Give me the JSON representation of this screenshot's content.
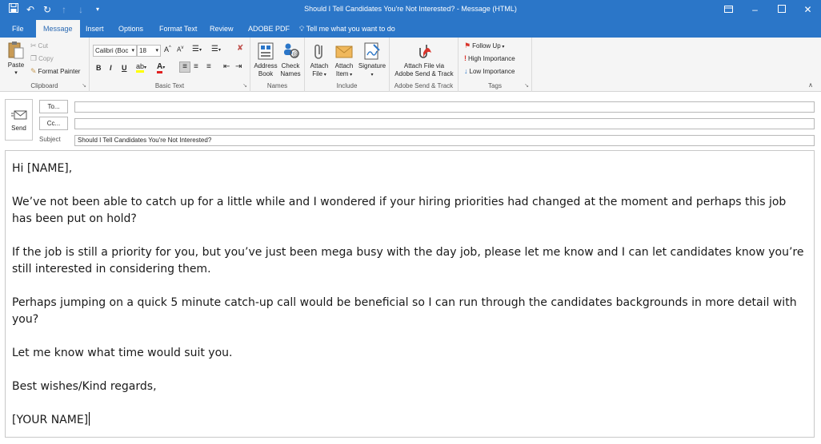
{
  "titlebar": {
    "title": "Should I Tell Candidates You're Not Interested?  -  Message (HTML)",
    "qat_icons": [
      "save-icon",
      "undo-icon",
      "redo-icon",
      "arrow-up-icon",
      "arrow-down-icon",
      "customize-icon"
    ],
    "controls": [
      "ribbon-display-icon",
      "minimize-icon",
      "maximize-icon",
      "close-icon"
    ]
  },
  "tabs": {
    "file": "File",
    "message": "Message",
    "insert": "Insert",
    "options": "Options",
    "format_text": "Format Text",
    "review": "Review",
    "adobe_pdf": "ADOBE PDF",
    "tell_me": "Tell me what you want to do"
  },
  "ribbon": {
    "clipboard": {
      "label": "Clipboard",
      "paste": "Paste",
      "cut": "Cut",
      "copy": "Copy",
      "format_painter": "Format Painter"
    },
    "basic_text": {
      "label": "Basic Text",
      "font_name": "Calibri (Boc",
      "font_size": "18",
      "bold": "B",
      "italic": "I",
      "underline": "U"
    },
    "names": {
      "label": "Names",
      "address_book_1": "Address",
      "address_book_2": "Book",
      "check_names_1": "Check",
      "check_names_2": "Names"
    },
    "include": {
      "label": "Include",
      "attach_file_1": "Attach",
      "attach_file_2": "File",
      "attach_item_1": "Attach",
      "attach_item_2": "Item",
      "signature": "Signature"
    },
    "adobe": {
      "label": "Adobe Send & Track",
      "attach_via_1": "Attach File via",
      "attach_via_2": "Adobe Send & Track"
    },
    "tags": {
      "label": "Tags",
      "follow_up": "Follow Up",
      "high_importance": "High Importance",
      "low_importance": "Low Importance"
    }
  },
  "compose": {
    "send": "Send",
    "to_button": "To...",
    "cc_button": "Cc...",
    "subject_label": "Subject",
    "to_value": "",
    "cc_value": "",
    "subject_value": "Should I Tell Candidates You're Not Interested?"
  },
  "body": {
    "greeting": "Hi [NAME],",
    "para1": "We’ve not been able to catch up for a little while and I wondered if your hiring priorities had changed at the moment and perhaps this job has been put on hold?",
    "para2": "If the job is still a priority for you, but you’ve just been mega busy with the day job, please let me know and I can let candidates know you’re still interested in considering them.",
    "para3": "Perhaps jumping on a quick 5 minute catch-up call would be beneficial so I can run through the candidates backgrounds in more detail with you?",
    "para4": "Let me know what time would suit you.",
    "signoff": "Best wishes/Kind regards,",
    "name": "[YOUR NAME]"
  },
  "colors": {
    "accent": "#2b76c8",
    "ribbon_bg": "#f5f5f5",
    "tab_active_text": "#2b6ab3"
  }
}
